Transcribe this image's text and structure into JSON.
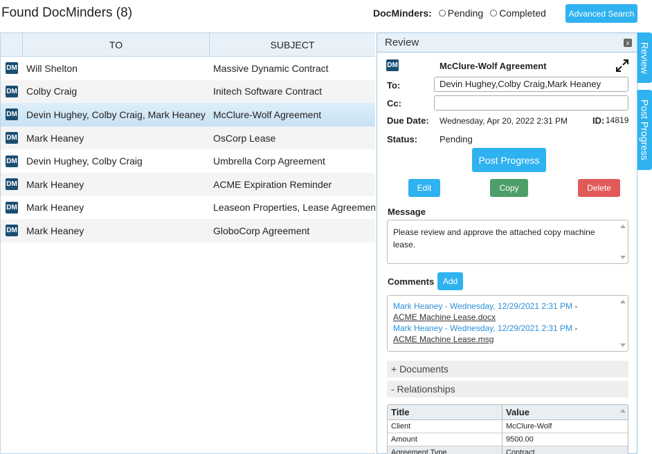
{
  "header": {
    "title": "Found DocMinders (8)",
    "filter_label": "DocMinders:",
    "filter_options": [
      "Pending",
      "Completed"
    ],
    "advanced_search": "Advanced Search"
  },
  "grid": {
    "columns": [
      "TO",
      "SUBJECT"
    ],
    "icon_text": "DM",
    "rows": [
      {
        "to": "Will Shelton",
        "subject": "Massive Dynamic Contract"
      },
      {
        "to": "Colby Craig",
        "subject": "Initech Software Contract"
      },
      {
        "to": "Devin Hughey, Colby Craig, Mark Heaney",
        "subject": "McClure-Wolf Agreement"
      },
      {
        "to": "Mark Heaney",
        "subject": "OsCorp Lease"
      },
      {
        "to": "Devin Hughey, Colby Craig",
        "subject": "Umbrella Corp Agreement"
      },
      {
        "to": "Mark Heaney",
        "subject": "ACME Expiration Reminder"
      },
      {
        "to": "Mark Heaney",
        "subject": "Leaseon Properties, Lease Agreement"
      },
      {
        "to": "Mark Heaney",
        "subject": "GloboCorp Agreement"
      }
    ],
    "selected_index": 2
  },
  "review": {
    "panel_title": "Review",
    "close": "x",
    "icon_text": "DM",
    "title": "McClure-Wolf Agreement",
    "to_label": "To:",
    "to_value": "Devin Hughey,Colby Craig,Mark Heaney",
    "cc_label": "Cc:",
    "cc_value": "",
    "due_label": "Due Date:",
    "due_value": "Wednesday, Apr 20, 2022 2:31 PM",
    "id_label": "ID:",
    "id_value": "14819",
    "status_label": "Status:",
    "status_value": "Pending",
    "post_progress": "Post Progress",
    "edit": "Edit",
    "copy": "Copy",
    "delete": "Delete",
    "message_label": "Message",
    "message": "Please review and approve the attached copy machine lease.",
    "comments_label": "Comments",
    "add": "Add",
    "comments": [
      {
        "author": "Mark Heaney - Wednesday, 12/29/2021 2:31 PM",
        "sep": " -",
        "file": "ACME Machine Lease.docx"
      },
      {
        "author": "Mark Heaney - Wednesday, 12/29/2021 2:31 PM",
        "sep": " -",
        "file": "ACME Machine Lease.msg"
      }
    ],
    "documents": "+ Documents",
    "relationships": "- Relationships",
    "rel_columns": [
      "Title",
      "Value"
    ],
    "rel_rows": [
      {
        "title": "Client",
        "value": "McClure-Wolf"
      },
      {
        "title": "Amount",
        "value": "9500.00"
      },
      {
        "title": "Agreement Type",
        "value": "Contract"
      }
    ]
  },
  "side_tabs": [
    "Review",
    "Post Progress"
  ],
  "colors": {
    "accent": "#2fb2f0",
    "copy": "#4d9e68",
    "delete": "#e15a5a",
    "dm_icon": "#1b4e72"
  }
}
